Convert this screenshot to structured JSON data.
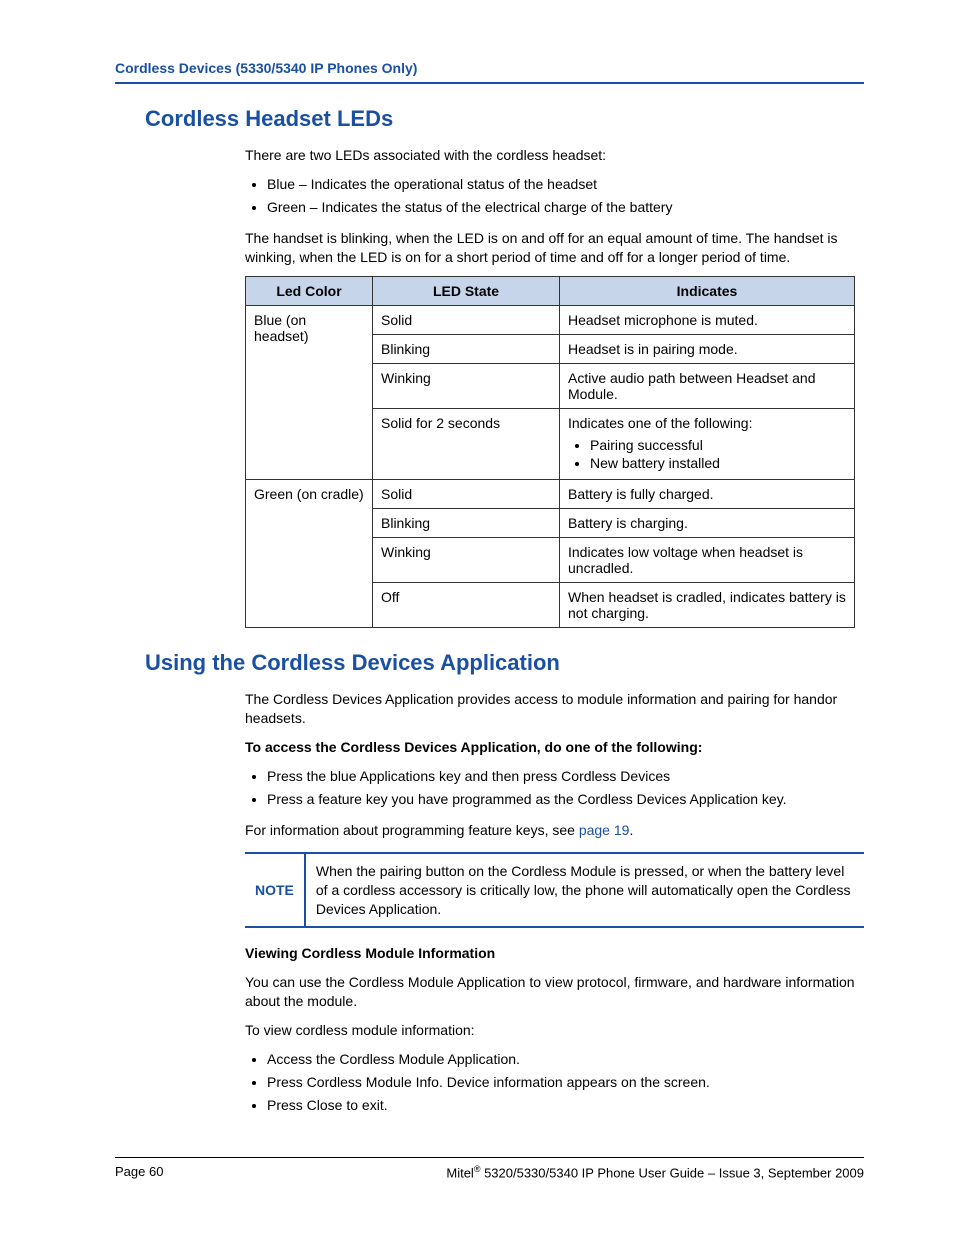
{
  "header": {
    "running": "Cordless Devices (5330/5340 IP Phones Only)"
  },
  "section1": {
    "title": "Cordless Headset LEDs",
    "intro": "There are two LEDs associated with the cordless headset:",
    "bullets": {
      "b1": "Blue – Indicates the operational status of the headset",
      "b2": "Green – Indicates the status of the electrical charge of the battery"
    },
    "para2": "The handset is blinking, when the LED is on and off for an equal amount of time. The handset is winking, when the LED is on for a short period of time and off for a longer period of time.",
    "table": {
      "headers": {
        "h1": "Led Color",
        "h2": "LED State",
        "h3": "Indicates"
      },
      "blue_label": "Blue (on headset)",
      "green_label": "Green (on cradle)",
      "rows": {
        "blue_solid": {
          "state": "Solid",
          "ind": "Headset microphone is muted."
        },
        "blue_blinking": {
          "state": "Blinking",
          "ind": "Headset is in pairing mode."
        },
        "blue_winking": {
          "state": "Winking",
          "ind": "Active audio path between Headset and Module."
        },
        "blue_solid2": {
          "state": "Solid for 2 seconds",
          "lead": "Indicates one of the following:",
          "li1": "Pairing successful",
          "li2": "New battery installed"
        },
        "green_solid": {
          "state": "Solid",
          "ind": "Battery is fully charged."
        },
        "green_blinking": {
          "state": "Blinking",
          "ind": "Battery is charging."
        },
        "green_winking": {
          "state": "Winking",
          "ind": "Indicates low voltage when headset is uncradled."
        },
        "green_off": {
          "state": "Off",
          "ind": "When headset is cradled, indicates battery is not charging."
        }
      }
    }
  },
  "section2": {
    "title": "Using the Cordless Devices Application",
    "intro": "The Cordless Devices Application provides access to module information and pairing for handor headsets.",
    "access_heading": "To access the Cordless Devices Application, do one of the following:",
    "access_bullets": {
      "b1": "Press the blue Applications key and then press Cordless Devices",
      "b2": "Press a feature key you have programmed as the Cordless Devices Application key."
    },
    "prog_text": "For information about programming feature keys, see ",
    "prog_link": "page 19",
    "prog_after": ".",
    "note_label": "NOTE",
    "note_text": "When the pairing button on the Cordless Module is pressed, or when the battery level of a cordless accessory is critically low, the phone will automatically open the Cordless Devices Application.",
    "view_heading": "Viewing Cordless Module Information",
    "view_para": "You can use the Cordless Module Application to view protocol, firmware, and hardware information about the module.",
    "view_intro": "To view cordless module information:",
    "view_bullets": {
      "b1": "Access the Cordless Module Application.",
      "b2": "Press Cordless Module Info. Device information appears on the screen.",
      "b3": "Press Close to exit."
    }
  },
  "footer": {
    "page": "Page 60",
    "brand": "Mitel",
    "right": " 5320/5330/5340 IP Phone User Guide – Issue 3, September 2009"
  }
}
